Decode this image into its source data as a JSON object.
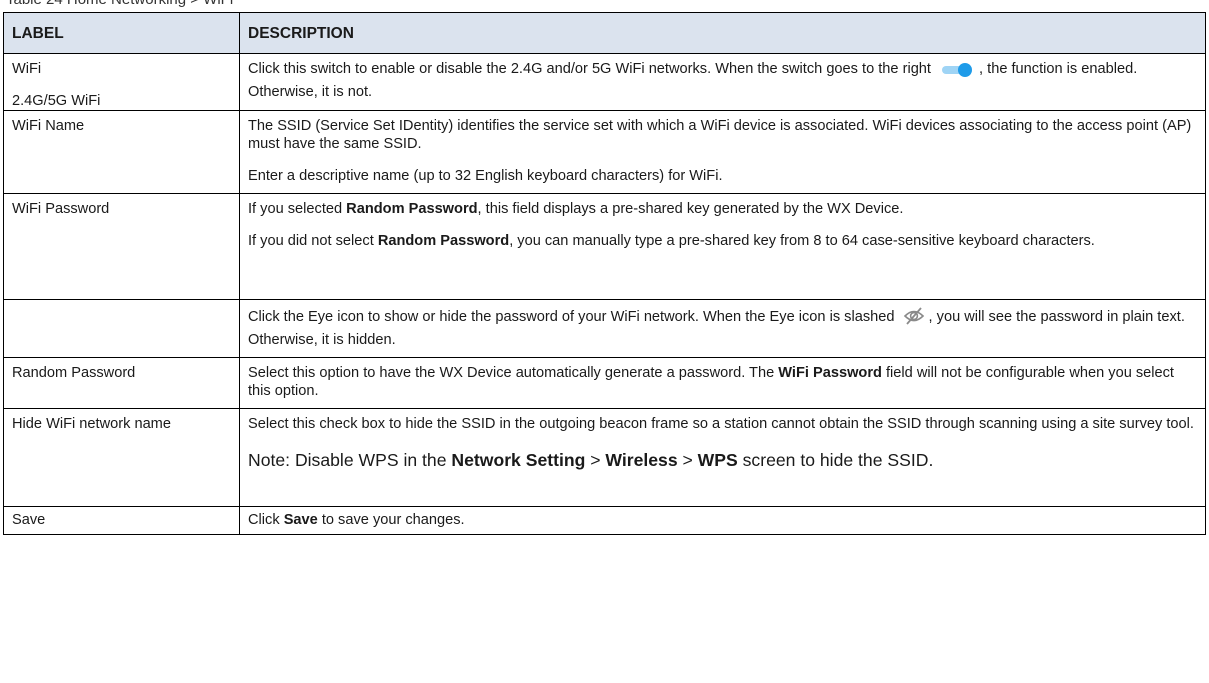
{
  "caption": "Table 24   Home Networking > WiFi",
  "table": {
    "headers": {
      "label": "LABEL",
      "description": "DESCRIPTION"
    },
    "rows": {
      "wifi": {
        "label_1": "WiFi",
        "label_2": "2.4G/5G WiFi",
        "desc_a": "Click this switch to enable or disable the 2.4G and/or 5G WiFi networks. When the switch goes to the right",
        "desc_b": ", the function is enabled. Otherwise, it is not."
      },
      "wifi_name": {
        "label": "WiFi Name",
        "desc_1": "The SSID (Service Set IDentity) identifies the service set with which a WiFi device is associated. WiFi devices associating to the access point (AP) must have the same SSID.",
        "desc_2": "Enter a descriptive name (up to 32 English keyboard characters) for WiFi."
      },
      "wifi_password": {
        "label": "WiFi Password",
        "desc_1a": "If you selected ",
        "desc_1b": "Random Password",
        "desc_1c": ", this field displays a pre-shared key generated by the WX Device.",
        "desc_2a": "If you did not select ",
        "desc_2b": "Random Password",
        "desc_2c": ", you can manually type a pre-shared key from 8 to 64 case-sensitive keyboard characters."
      },
      "eye": {
        "label": "",
        "desc_a": "Click the Eye icon to show or hide the password of your WiFi network. When the Eye icon is slashed",
        "desc_b": ", you will see the password in plain text. Otherwise, it is hidden."
      },
      "random_password": {
        "label": "Random Password",
        "desc_a": "Select this option to have the WX Device automatically generate a password. The ",
        "desc_b": "WiFi Password",
        "desc_c": " field will not be configurable when you select this option."
      },
      "hide_ssid": {
        "label": "Hide WiFi network name",
        "desc_1": "Select this check box to hide the SSID in the outgoing beacon frame so a station cannot obtain the SSID through scanning using a site survey tool.",
        "note_a": "Note: Disable WPS in the ",
        "note_b": "Network Setting",
        "note_c": " > ",
        "note_d": "Wireless",
        "note_e": " > ",
        "note_f": "WPS",
        "note_g": " screen to hide the SSID."
      },
      "save": {
        "label": "Save",
        "desc_a": "Click ",
        "desc_b": "Save",
        "desc_c": " to save your changes."
      }
    }
  },
  "icons": {
    "toggle": "toggle-switch-on-icon",
    "eye_slash": "eye-slashed-icon"
  },
  "colors": {
    "header_bg": "#dbe3ee",
    "toggle_track": "#9fd4f5",
    "toggle_knob": "#1e9be9",
    "border": "#000000"
  }
}
